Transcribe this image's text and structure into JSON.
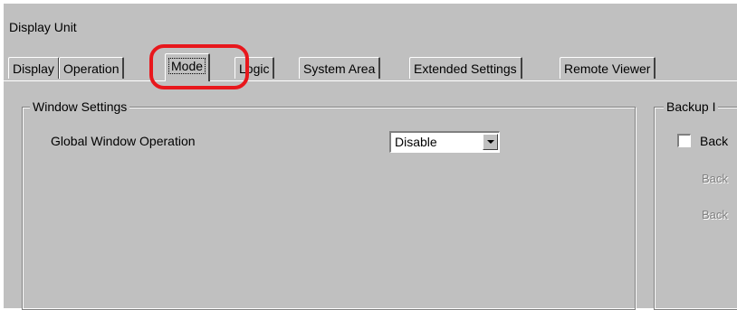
{
  "window": {
    "title": "Display Unit"
  },
  "tabs": [
    {
      "label": "Display"
    },
    {
      "label": "Operation"
    },
    {
      "label": "Mode"
    },
    {
      "label": "Logic"
    },
    {
      "label": "System Area"
    },
    {
      "label": "Extended Settings"
    },
    {
      "label": "Remote Viewer"
    }
  ],
  "active_tab": "Mode",
  "window_settings": {
    "group_label": "Window Settings",
    "global_window_operation": {
      "label": "Global Window Operation",
      "value": "Disable"
    }
  },
  "backup": {
    "group_label": "Backup I",
    "checkbox_label": "Back",
    "disabled_label_1": "Back",
    "disabled_label_2": "Back"
  },
  "colors": {
    "highlight": "#e8171c",
    "panel": "#c0c0c0"
  }
}
